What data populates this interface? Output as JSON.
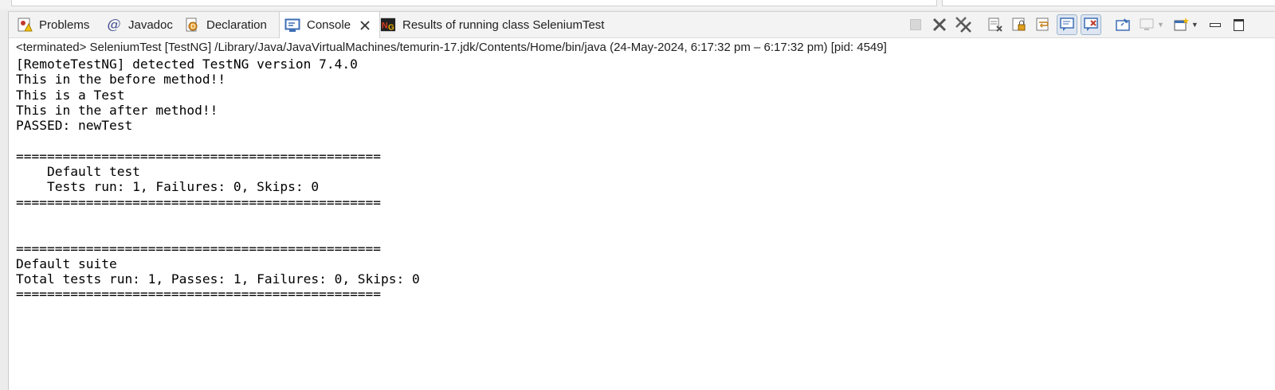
{
  "tabs": [
    {
      "label": "Problems",
      "icon": "problems-icon"
    },
    {
      "label": "Javadoc",
      "icon": "javadoc-icon"
    },
    {
      "label": "Declaration",
      "icon": "declaration-icon"
    },
    {
      "label": "Console",
      "icon": "console-icon",
      "active": true
    },
    {
      "label": "Results of running class SeleniumTest",
      "icon": "testng-icon"
    }
  ],
  "status": "<terminated> SeleniumTest [TestNG] /Library/Java/JavaVirtualMachines/temurin-17.jdk/Contents/Home/bin/java  (24-May-2024, 6:17:32 pm – 6:17:32 pm) [pid: 4549]",
  "console_lines": [
    "[RemoteTestNG] detected TestNG version 7.4.0",
    "This in the before method!!",
    "This is a Test",
    "This in the after method!!",
    "PASSED: newTest",
    "",
    "===============================================",
    "    Default test",
    "    Tests run: 1, Failures: 0, Skips: 0",
    "===============================================",
    "",
    "",
    "===============================================",
    "Default suite",
    "Total tests run: 1, Passes: 1, Failures: 0, Skips: 0",
    "==============================================="
  ],
  "colors": {
    "accent": "#3c6eb4",
    "panel_bg": "#ffffff",
    "tabbar_bg": "#f3f3f3"
  }
}
